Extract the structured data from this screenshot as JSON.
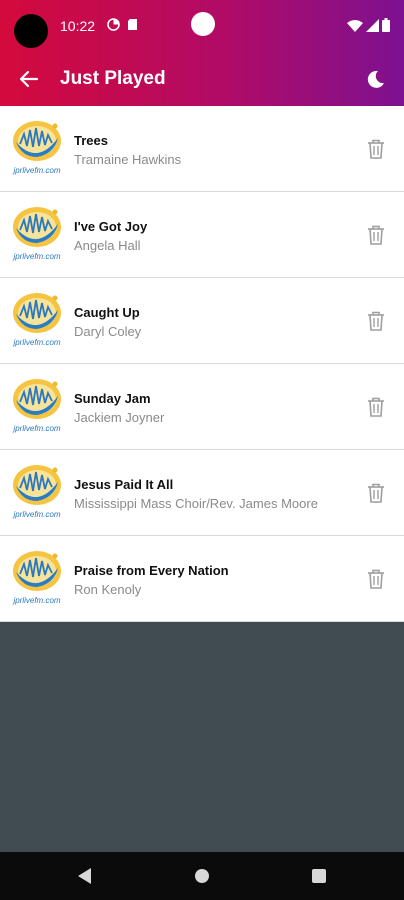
{
  "status_bar": {
    "time": "10:22"
  },
  "header": {
    "title": "Just Played"
  },
  "logo_text": "jprlivefm.com",
  "colors": {
    "header_start": "#d40a3c",
    "header_end": "#7d1191",
    "background": "#414b52",
    "navbar": "#0b0b0b"
  },
  "icons": {
    "back": "arrow-left-icon",
    "theme": "moon-icon",
    "delete": "trash-icon"
  },
  "songs": [
    {
      "title": "Trees",
      "artist": "Tramaine Hawkins"
    },
    {
      "title": "I've Got Joy",
      "artist": "Angela Hall"
    },
    {
      "title": "Caught Up",
      "artist": "Daryl Coley"
    },
    {
      "title": "Sunday Jam",
      "artist": "Jackiem Joyner"
    },
    {
      "title": "Jesus Paid It All",
      "artist": "Mississippi Mass Choir/Rev. James Moore"
    },
    {
      "title": "Praise from Every Nation",
      "artist": "Ron Kenoly"
    }
  ]
}
